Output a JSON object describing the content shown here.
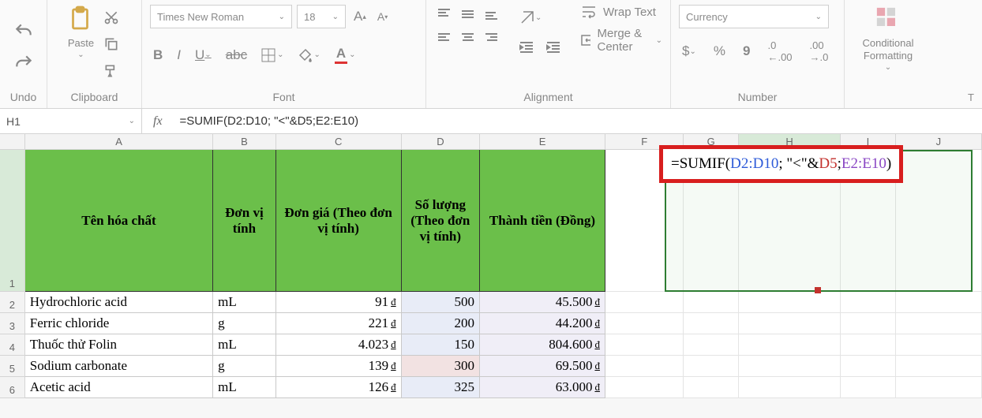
{
  "ribbon": {
    "undo_label": "Undo",
    "clipboard": {
      "label": "Clipboard",
      "paste": "Paste"
    },
    "font": {
      "label": "Font",
      "name": "Times New Roman",
      "size": "18",
      "bold": "B",
      "italic": "I",
      "underline": "U",
      "strike": "abc"
    },
    "alignment": {
      "label": "Alignment",
      "wrap": "Wrap Text",
      "merge": "Merge & Center"
    },
    "number": {
      "label": "Number",
      "format": "Currency",
      "currency": "$",
      "percent": "%",
      "comma": "9"
    },
    "cond": {
      "label": "Conditional\nFormatting"
    },
    "tab_t": "T"
  },
  "formula_bar": {
    "name_box": "H1",
    "fx": "fx",
    "formula": "=SUMIF(D2:D10; \"<\"&D5;E2:E10)"
  },
  "columns": [
    "A",
    "B",
    "C",
    "D",
    "E",
    "F",
    "G",
    "H",
    "I",
    "J"
  ],
  "headers": {
    "a": "Tên hóa chất",
    "b": "Đơn vị tính",
    "c": "Đơn giá (Theo đơn vị tính)",
    "d": "Số lượng (Theo đơn vị tính)",
    "e": "Thành tiền (Đồng)"
  },
  "rows": [
    {
      "n": "2",
      "a": "Hydrochloric acid",
      "b": "mL",
      "c": "91",
      "d": "500",
      "e": "45.500"
    },
    {
      "n": "3",
      "a": "Ferric chloride",
      "b": "g",
      "c": "221",
      "d": "200",
      "e": "44.200"
    },
    {
      "n": "4",
      "a": "Thuốc thử Folin",
      "b": "mL",
      "c": "4.023",
      "d": "150",
      "e": "804.600"
    },
    {
      "n": "5",
      "a": "Sodium carbonate",
      "b": "g",
      "c": "139",
      "d": "300",
      "e": "69.500"
    },
    {
      "n": "6",
      "a": "Acetic acid",
      "b": "mL",
      "c": "126",
      "d": "325",
      "e": "63.000"
    }
  ],
  "overlay": {
    "prefix": "=SUMIF(",
    "r1": "D2:D10",
    "mid1": "; \"<\"&",
    "r2": "D5",
    "mid2": ";",
    "r3": "E2:E10",
    "suffix": ")"
  },
  "dong": "đ"
}
